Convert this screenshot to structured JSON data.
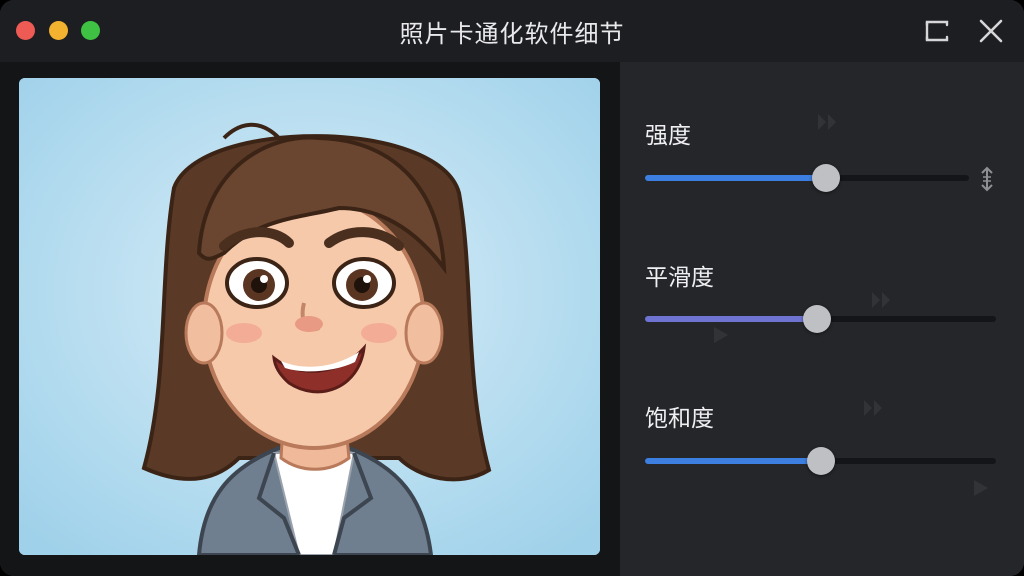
{
  "window": {
    "title": "照片卡通化软件细节"
  },
  "colors": {
    "background": "#1c1d20",
    "panel": "#252629",
    "accent_blue": "#3d7fe0",
    "accent_purple": "#6f74d2",
    "thumb": "#bfc0c4"
  },
  "preview": {
    "description_icon": "cartoon-portrait-image"
  },
  "sliders": [
    {
      "label": "强度",
      "value": 0.56,
      "fill": "#3d7fe0"
    },
    {
      "label": "平滑度",
      "value": 0.49,
      "fill": "#6f74d2"
    },
    {
      "label": "饱和度",
      "value": 0.5,
      "fill": "#3d7fe0"
    }
  ]
}
